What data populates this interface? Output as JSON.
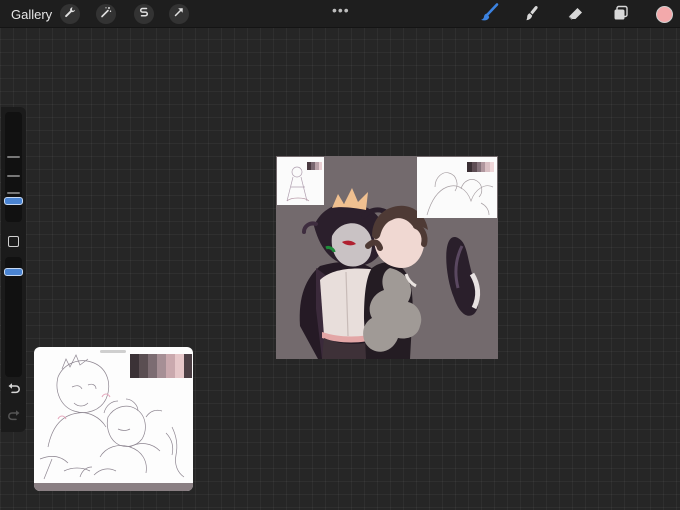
{
  "topbar": {
    "gallery_label": "Gallery",
    "left_tools": [
      "wrench-icon",
      "magic-wand-icon",
      "selection-icon",
      "transform-arrow-icon"
    ],
    "more_label": "•••",
    "right_tools": [
      "brush-icon",
      "smudge-icon",
      "eraser-icon",
      "layers-icon"
    ],
    "active_tool": "brush",
    "current_color": "#f3a9ab"
  },
  "sidebar": {
    "brush_size_level": 0.55,
    "opacity_level": 0.9
  },
  "reference": {
    "palette": [
      "#3b3236",
      "#5a4e52",
      "#7c6c72",
      "#a68f95",
      "#caa9ae",
      "#e6c7c9",
      "#4c3f44"
    ]
  },
  "canvas": {
    "background": "#736a6d",
    "ref_left_palette": [
      "#4a3a41",
      "#7a6870",
      "#b9a2a8",
      "#e9cfd3"
    ],
    "ref_right_palette": [
      "#3a2f34",
      "#5e4d54",
      "#84727a",
      "#b0979e",
      "#d9bfc3",
      "#f0d7d9"
    ]
  },
  "colors": {
    "accent": "#4a84d2",
    "background": "#262626",
    "topbar": "#1e1e1e"
  }
}
